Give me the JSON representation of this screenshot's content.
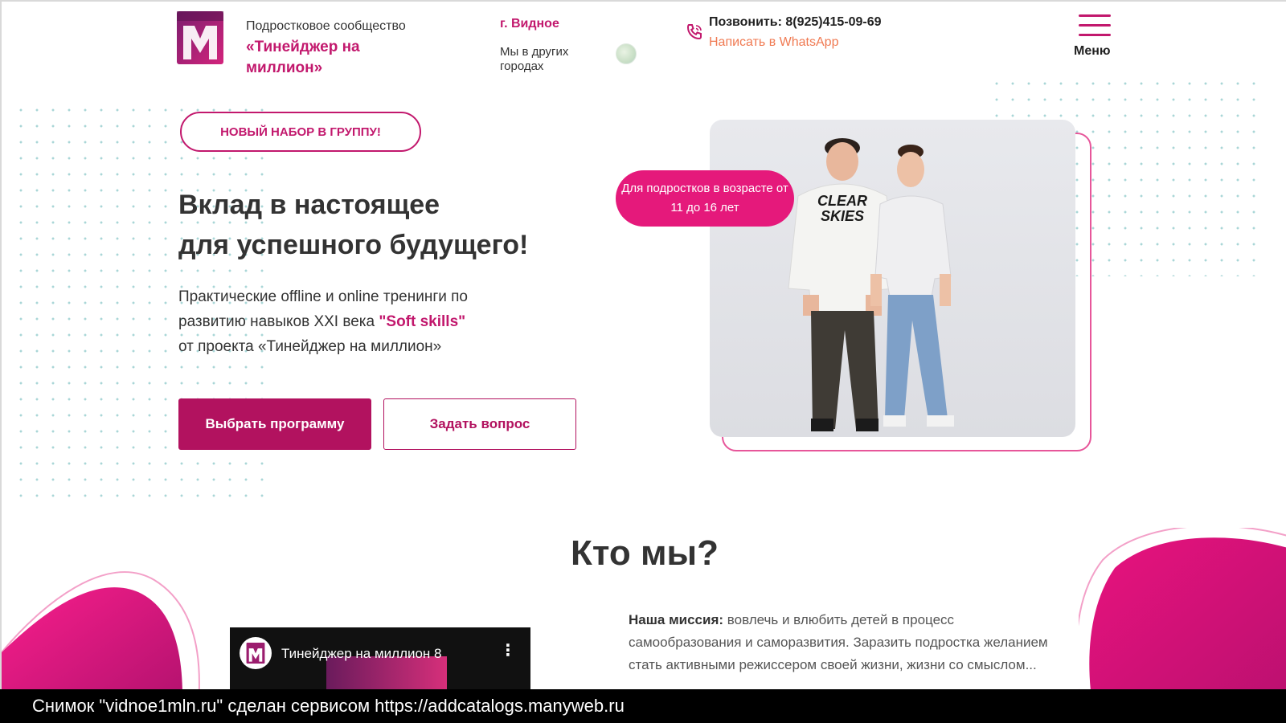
{
  "header": {
    "brand_subtitle": "Подростковое сообщество",
    "brand_name": "«Тинейджер на миллион»",
    "city": "г. Видное",
    "other_cities": "Мы в других городах",
    "phone": "Позвонить: 8(925)415-09-69",
    "whatsapp": "Написать в WhatsApp",
    "menu_label": "Меню"
  },
  "hero": {
    "badge": "НОВЫЙ НАБОР В ГРУППУ!",
    "title_line1": "Вклад в настоящее",
    "title_line2": "для успешного будущего!",
    "text_line1": "Практические offline и online тренинги по",
    "text_line2_prefix": "развитию навыков XXI века ",
    "text_highlight": "\"Soft skills\"",
    "text_line3": "от проекта «Тинейджер на миллион»",
    "primary_button": "Выбрать программу",
    "secondary_button": "Задать вопрос",
    "age_pill": "Для подростков в возрасте от 11 до 16 лет",
    "hoodie_print": "CLEAR SKIES"
  },
  "about": {
    "title": "Кто мы?",
    "video_title": "Тинейджер на миллион 8",
    "mission_label": "Наша миссия:",
    "mission_text": " вовлечь и влюбить детей в процесс самообразования и саморазвития. Заразить подростка желанием стать активными режиссером своей жизни, жизни со смыслом..."
  },
  "caption": "Снимок \"vidnoe1mln.ru\" сделан сервисом https://addcatalogs.manyweb.ru",
  "colors": {
    "brand": "#c2186d",
    "button": "#b2125f",
    "pill": "#e5197b",
    "whatsapp": "#f07a52"
  }
}
